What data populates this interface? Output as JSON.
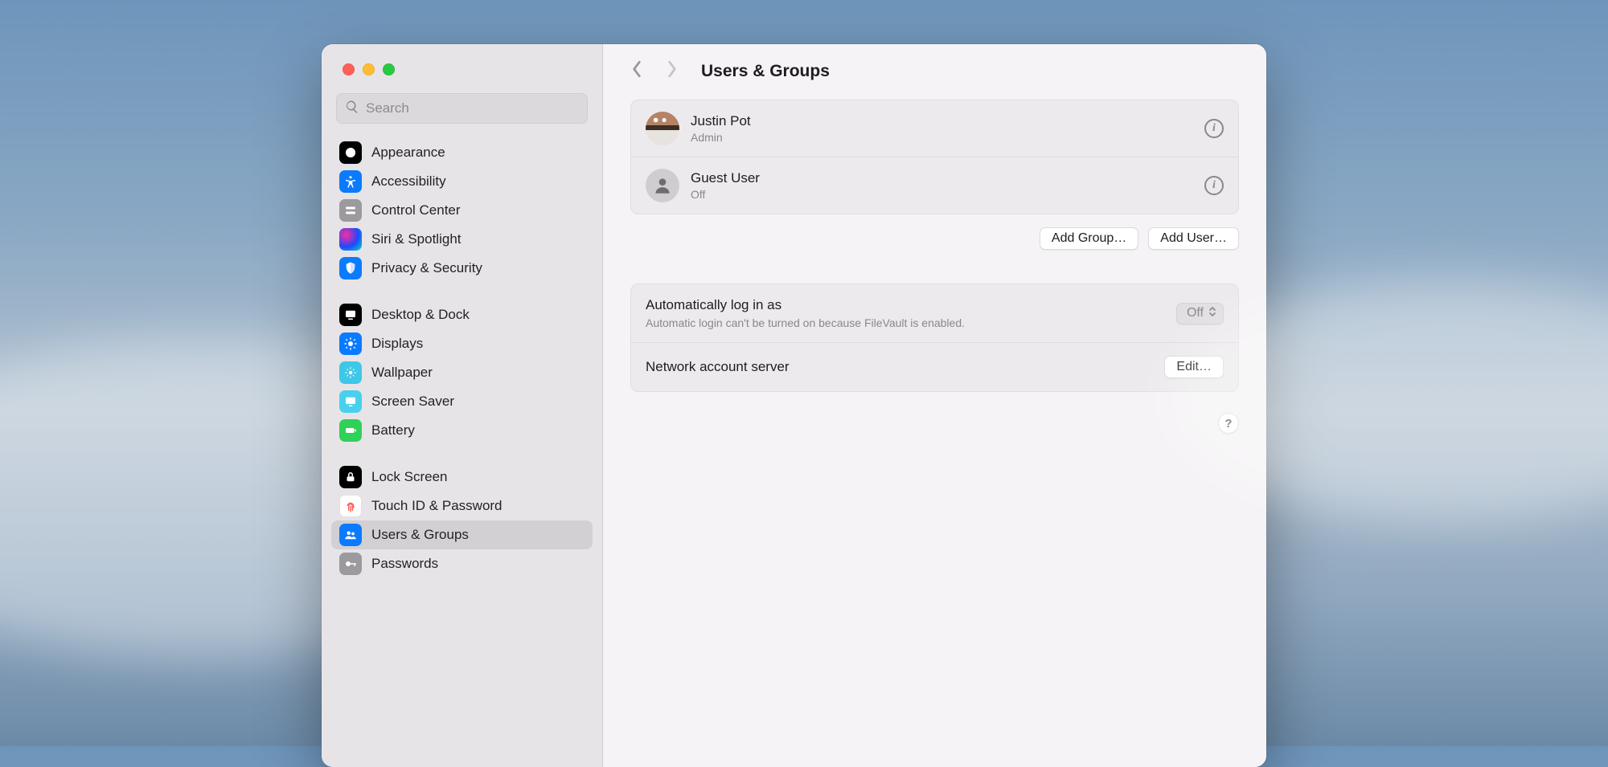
{
  "header": {
    "title": "Users & Groups"
  },
  "search": {
    "placeholder": "Search"
  },
  "sidebar": {
    "items": [
      {
        "label": "Appearance"
      },
      {
        "label": "Accessibility"
      },
      {
        "label": "Control Center"
      },
      {
        "label": "Siri & Spotlight"
      },
      {
        "label": "Privacy & Security"
      },
      {
        "label": "Desktop & Dock"
      },
      {
        "label": "Displays"
      },
      {
        "label": "Wallpaper"
      },
      {
        "label": "Screen Saver"
      },
      {
        "label": "Battery"
      },
      {
        "label": "Lock Screen"
      },
      {
        "label": "Touch ID & Password"
      },
      {
        "label": "Users & Groups"
      },
      {
        "label": "Passwords"
      }
    ]
  },
  "users": [
    {
      "name": "Justin Pot",
      "role": "Admin"
    },
    {
      "name": "Guest User",
      "role": "Off"
    }
  ],
  "buttons": {
    "add_group": "Add Group…",
    "add_user": "Add User…",
    "edit": "Edit…",
    "help": "?"
  },
  "auto_login": {
    "title": "Automatically log in as",
    "note": "Automatic login can't be turned on because FileVault is enabled.",
    "value": "Off"
  },
  "network_server": {
    "title": "Network account server"
  }
}
